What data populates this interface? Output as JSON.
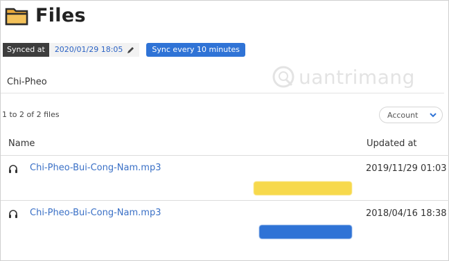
{
  "header": {
    "title": "Files"
  },
  "sync": {
    "synced_label": "Synced at",
    "synced_value": "2020/01/29 18:05",
    "sync_button": "Sync every 10 minutes"
  },
  "search": {
    "value": "Chi-Pheo"
  },
  "list": {
    "count_text": "1 to 2 of 2 files",
    "account_filter": "Account",
    "columns": {
      "name": "Name",
      "updated": "Updated at"
    },
    "rows": [
      {
        "name": "Chi-Pheo-Bui-Cong-Nam.mp3",
        "updated": "2019/11/29 01:03",
        "tag_color": "#f7d94c"
      },
      {
        "name": "Chi-Pheo-Bui-Cong-Nam.mp3",
        "updated": "2018/04/16 18:38",
        "tag_color": "#2f73d6"
      }
    ]
  },
  "watermark": {
    "text": "uantrimang"
  }
}
